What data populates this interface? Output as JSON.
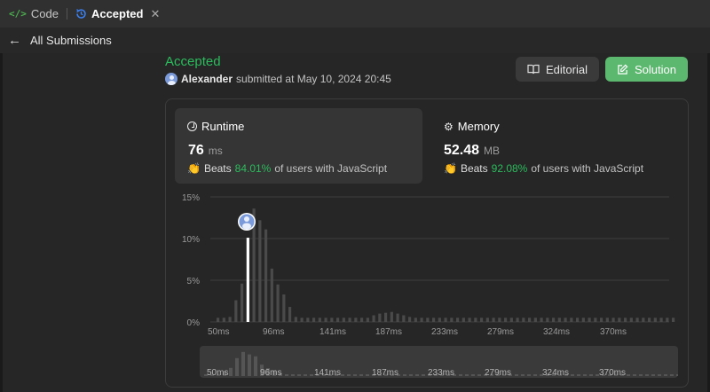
{
  "tabs": {
    "code_label": "Code",
    "code_icon": "code-brackets-icon",
    "accepted_label": "Accepted",
    "accepted_icon": "history-icon",
    "close_icon": "close-icon"
  },
  "nav": {
    "back_label": "All Submissions"
  },
  "submission": {
    "status": "Accepted",
    "user": "Alexander",
    "submitted_text": "submitted at May 10, 2024 20:45"
  },
  "buttons": {
    "editorial": "Editorial",
    "solution": "Solution"
  },
  "runtime": {
    "label": "Runtime",
    "value": "76",
    "unit": "ms",
    "beats_word": "Beats",
    "beats_pct": "84.01%",
    "beats_suffix": "of users with JavaScript"
  },
  "memory": {
    "label": "Memory",
    "value": "52.48",
    "unit": "MB",
    "beats_word": "Beats",
    "beats_pct": "92.08%",
    "beats_suffix": "of users with JavaScript"
  },
  "colors": {
    "accepted_green": "#2cbb5d",
    "solution_button": "#5bb86e",
    "highlight_bar": "#ffffff",
    "bar": "#4a4a4a"
  },
  "chart_data": {
    "type": "bar",
    "title": "",
    "xlabel": "",
    "ylabel": "",
    "y_ticks": [
      "15%",
      "10%",
      "5%",
      "0%"
    ],
    "ylim": [
      0,
      15
    ],
    "x_tick_labels": [
      "50ms",
      "96ms",
      "141ms",
      "187ms",
      "233ms",
      "279ms",
      "324ms",
      "370ms"
    ],
    "grid": true,
    "highlight_bin": 5,
    "values": [
      0.5,
      0.5,
      0.6,
      2.6,
      4.6,
      10.1,
      13.6,
      12.2,
      11.1,
      6.4,
      4.5,
      3.3,
      1.8,
      0.6,
      0.5,
      0.5,
      0.5,
      0.5,
      0.5,
      0.5,
      0.5,
      0.5,
      0.5,
      0.5,
      0.5,
      0.5,
      0.8,
      1.0,
      1.1,
      1.2,
      1.0,
      0.8,
      0.6,
      0.5,
      0.5,
      0.5,
      0.5,
      0.5,
      0.5,
      0.5,
      0.5,
      0.5,
      0.5,
      0.5,
      0.5,
      0.5,
      0.5,
      0.5,
      0.5,
      0.5,
      0.5,
      0.5,
      0.5,
      0.5,
      0.5,
      0.5,
      0.5,
      0.5,
      0.5,
      0.5,
      0.5,
      0.5,
      0.5,
      0.5,
      0.5,
      0.5,
      0.5,
      0.5,
      0.5,
      0.5,
      0.5,
      0.5,
      0.5,
      0.5,
      0.5,
      0.5,
      0.5
    ]
  }
}
